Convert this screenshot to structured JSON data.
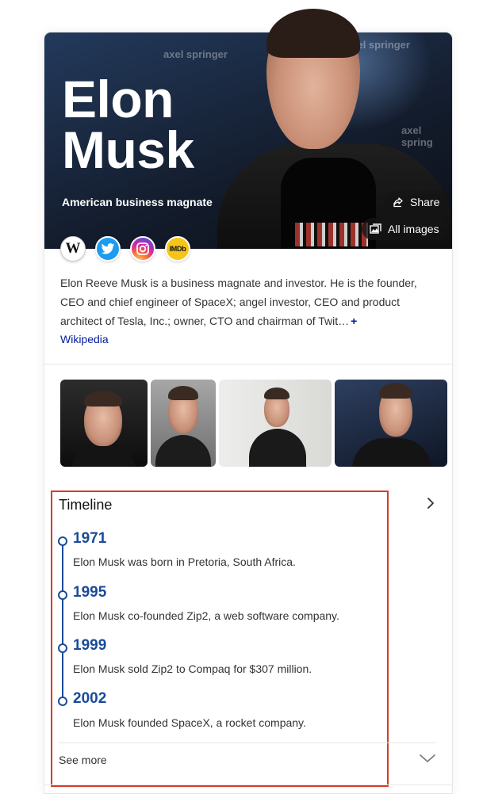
{
  "hero": {
    "title_line1": "Elon",
    "title_line2": "Musk",
    "subtitle": "American business magnate",
    "share_label": "Share",
    "all_images_label": "All images",
    "watermark1": "axel springer",
    "watermark2": "axel spring"
  },
  "social_links": [
    {
      "name": "Wikipedia",
      "icon": "wikipedia-icon",
      "glyph": "W"
    },
    {
      "name": "Twitter",
      "icon": "twitter-icon"
    },
    {
      "name": "Instagram",
      "icon": "instagram-icon"
    },
    {
      "name": "IMDb",
      "icon": "imdb-icon",
      "glyph": "IMDb"
    }
  ],
  "description": {
    "text": "Elon Reeve Musk is a business magnate and investor. He is the founder, CEO and chief engineer of SpaceX; angel investor, CEO and product architect of Tesla, Inc.; owner, CTO and chairman of Twit…",
    "expand": "+",
    "source": "Wikipedia"
  },
  "timeline": {
    "title": "Timeline",
    "events": [
      {
        "year": "1971",
        "text": "Elon Musk was born in Pretoria, South Africa."
      },
      {
        "year": "1995",
        "text": "Elon Musk co-founded Zip2, a web software company."
      },
      {
        "year": "1999",
        "text": "Elon Musk sold Zip2 to Compaq for $307 million."
      },
      {
        "year": "2002",
        "text": "Elon Musk founded SpaceX, a rocket company."
      }
    ],
    "see_more": "See more"
  },
  "colors": {
    "link": "#001ba0",
    "timeline_accent": "#1a4b99",
    "highlight_border": "#d83a27"
  }
}
